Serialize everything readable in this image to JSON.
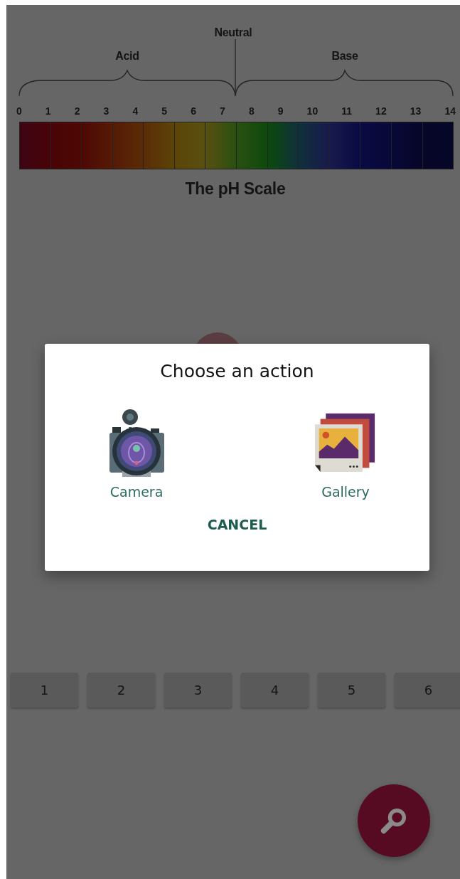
{
  "ph_scale": {
    "neutral_label": "Neutral",
    "acid_label": "Acid",
    "base_label": "Base",
    "ticks": [
      "0",
      "1",
      "2",
      "3",
      "4",
      "5",
      "6",
      "7",
      "8",
      "9",
      "10",
      "11",
      "12",
      "13",
      "14"
    ],
    "title": "The pH Scale"
  },
  "dialog": {
    "title": "Choose an action",
    "options": [
      {
        "kind": "camera",
        "label": "Camera"
      },
      {
        "kind": "gallery",
        "label": "Gallery"
      }
    ],
    "cancel": "CANCEL"
  },
  "number_buttons": [
    "1",
    "2",
    "3",
    "4",
    "5",
    "6"
  ]
}
